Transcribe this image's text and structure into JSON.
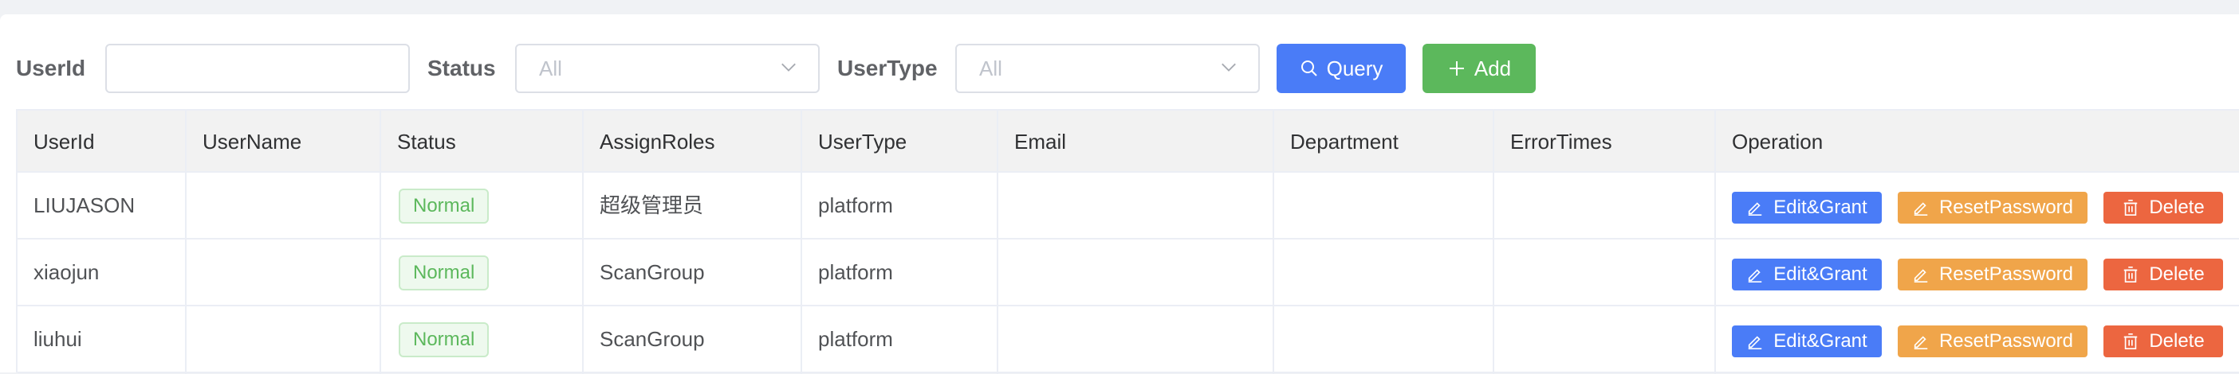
{
  "filters": {
    "userid_label": "UserId",
    "userid_value": "",
    "status_label": "Status",
    "status_value": "All",
    "usertype_label": "UserType",
    "usertype_value": "All",
    "query_label": "Query",
    "add_label": "Add"
  },
  "table": {
    "columns": [
      "UserId",
      "UserName",
      "Status",
      "AssignRoles",
      "UserType",
      "Email",
      "Department",
      "ErrorTimes",
      "Operation"
    ],
    "rows": [
      {
        "userid": "LIUJASON",
        "username": "",
        "status": "Normal",
        "roles": "超级管理员",
        "usertype": "platform",
        "email": "",
        "department": "",
        "errortimes": ""
      },
      {
        "userid": "xiaojun",
        "username": "",
        "status": "Normal",
        "roles": "ScanGroup",
        "usertype": "platform",
        "email": "",
        "department": "",
        "errortimes": ""
      },
      {
        "userid": "liuhui",
        "username": "",
        "status": "Normal",
        "roles": "ScanGroup",
        "usertype": "platform",
        "email": "",
        "department": "",
        "errortimes": ""
      }
    ],
    "actions": {
      "edit_label": "Edit&Grant",
      "reset_label": "ResetPassword",
      "delete_label": "Delete"
    }
  },
  "colors": {
    "primary": "#4a7cf7",
    "success": "#5cb85c",
    "warning": "#f0a54a",
    "danger": "#ec6640"
  },
  "icons": [
    "search-icon",
    "plus-icon",
    "edit-icon",
    "trash-icon",
    "chevron-down-icon"
  ]
}
